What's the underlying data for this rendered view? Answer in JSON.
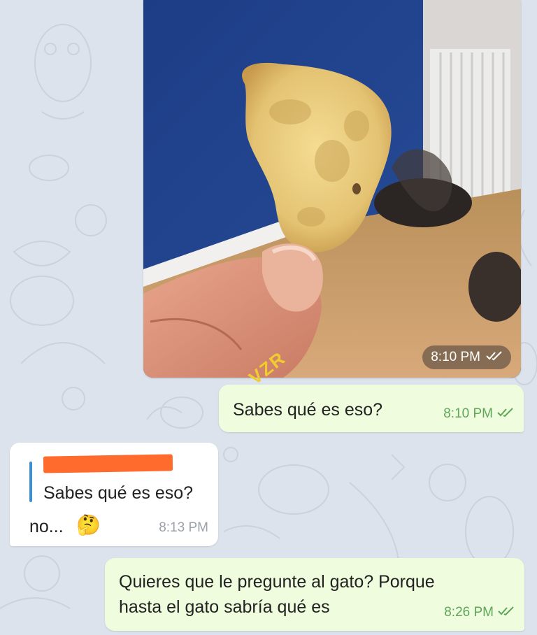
{
  "chat": {
    "image_message": {
      "time": "8:10 PM"
    },
    "msg1": {
      "text": "Sabes qué es eso?",
      "time": "8:10 PM"
    },
    "msg2": {
      "reply_quote": "Sabes qué es eso?",
      "text": "no...",
      "emoji": "🤔",
      "time": "8:13 PM"
    },
    "msg3": {
      "line1": "Quieres que le pregunte al gato? Porque",
      "line2": "hasta el gato sabría qué es",
      "time": "8:26 PM"
    }
  },
  "watermark": "VZR",
  "colors": {
    "background": "#dde3ec",
    "outgoing_bubble": "#effdde",
    "incoming_bubble": "#ffffff",
    "outgoing_meta": "#5ea658",
    "reply_bar": "#3f8fd0",
    "redaction": "#ff6a2d"
  },
  "icons": [
    "double-check-icon",
    "thinking-face-emoji"
  ]
}
